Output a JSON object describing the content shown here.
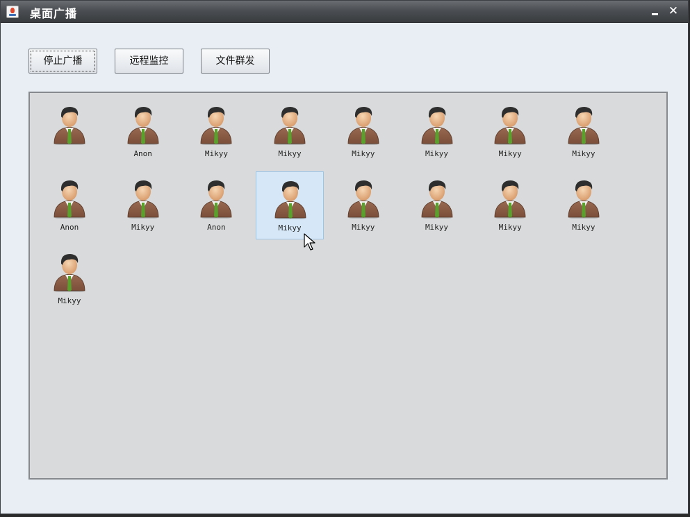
{
  "window": {
    "title": "桌面广播",
    "minimize_icon": "minimize-icon",
    "close_label": "✕"
  },
  "toolbar": {
    "stop_broadcast_label": "停止广播",
    "remote_monitor_label": "远程监控",
    "file_send_label": "文件群发"
  },
  "clients": [
    {
      "name": "",
      "selected": false
    },
    {
      "name": "Anon",
      "selected": false
    },
    {
      "name": "Mikyy",
      "selected": false
    },
    {
      "name": "Mikyy",
      "selected": false
    },
    {
      "name": "Mikyy",
      "selected": false
    },
    {
      "name": "Mikyy",
      "selected": false
    },
    {
      "name": "Mikyy",
      "selected": false
    },
    {
      "name": "Mikyy",
      "selected": false
    },
    {
      "name": "Anon",
      "selected": false
    },
    {
      "name": "Mikyy",
      "selected": false
    },
    {
      "name": "Anon",
      "selected": false
    },
    {
      "name": "Mikyy",
      "selected": true
    },
    {
      "name": "Mikyy",
      "selected": false
    },
    {
      "name": "Mikyy",
      "selected": false
    },
    {
      "name": "Mikyy",
      "selected": false
    },
    {
      "name": "Mikyy",
      "selected": false
    },
    {
      "name": "Mikyy",
      "selected": false
    }
  ],
  "colors": {
    "selected_bg": "#d6e8f7",
    "panel_bg": "#d9dadb",
    "suit": "#7a4e3a",
    "tie": "#5aa02c"
  }
}
